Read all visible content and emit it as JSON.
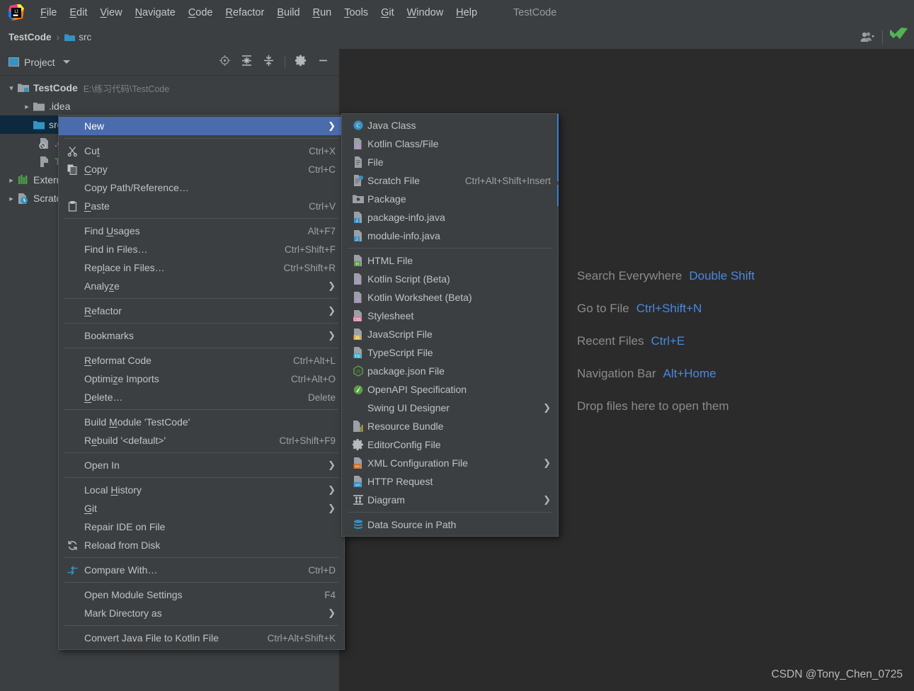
{
  "window": {
    "title": "TestCode",
    "progress_visible": true
  },
  "menubar": {
    "items": [
      {
        "label": "File"
      },
      {
        "label": "Edit"
      },
      {
        "label": "View"
      },
      {
        "label": "Navigate"
      },
      {
        "label": "Code"
      },
      {
        "label": "Refactor"
      },
      {
        "label": "Build"
      },
      {
        "label": "Run"
      },
      {
        "label": "Tools"
      },
      {
        "label": "Git"
      },
      {
        "label": "Window"
      },
      {
        "label": "Help"
      }
    ]
  },
  "breadcrumb": {
    "root": "TestCode",
    "separator": "›",
    "leaf": "src"
  },
  "toolwindow": {
    "title": "Project",
    "actions": [
      "locate-icon",
      "expand-all-icon",
      "collapse-all-icon",
      "settings-gear-icon",
      "hide-icon"
    ],
    "tree": [
      {
        "label": "TestCode",
        "detail": "E:\\练习代码\\TestCode",
        "arrow": "∨",
        "icon": "module-icon",
        "bold": true,
        "indent": 0,
        "selected": false
      },
      {
        "label": ".idea",
        "detail": "",
        "arrow": "›",
        "icon": "folder-icon",
        "bold": false,
        "indent": 1,
        "selected": false
      },
      {
        "label": "src",
        "detail": "",
        "arrow": "",
        "icon": "source-folder-icon",
        "bold": false,
        "indent": 1,
        "selected": true
      },
      {
        "label": ".gitignore",
        "detail": "",
        "arrow": "",
        "icon": "ignored-file-icon",
        "bold": false,
        "indent": 2,
        "selected": false
      },
      {
        "label": "TestCode.iml",
        "detail": "",
        "arrow": "",
        "icon": "iml-file-icon",
        "bold": false,
        "indent": 2,
        "selected": false
      },
      {
        "label": "External Libraries",
        "detail": "",
        "arrow": "›",
        "icon": "libraries-icon",
        "bold": false,
        "indent": 0,
        "selected": false
      },
      {
        "label": "Scratches and Consoles",
        "detail": "",
        "arrow": "›",
        "icon": "scratches-icon",
        "bold": false,
        "indent": 0,
        "selected": false
      }
    ]
  },
  "context_menu": {
    "groups": [
      [
        {
          "label": "New",
          "accel": "",
          "icon": "",
          "submenu": true,
          "highlighted": true
        }
      ],
      [
        {
          "label": "Cut",
          "accel": "Ctrl+X",
          "icon": "scissors-icon",
          "submenu": false,
          "highlighted": false,
          "mnemonic_index": 2
        },
        {
          "label": "Copy",
          "accel": "Ctrl+C",
          "icon": "copy-icon",
          "submenu": false,
          "highlighted": false,
          "mnemonic_index": 0
        },
        {
          "label": "Copy Path/Reference…",
          "accel": "",
          "icon": "",
          "submenu": false,
          "highlighted": false
        },
        {
          "label": "Paste",
          "accel": "Ctrl+V",
          "icon": "clipboard-icon",
          "submenu": false,
          "highlighted": false,
          "mnemonic_index": 0
        }
      ],
      [
        {
          "label": "Find Usages",
          "accel": "Alt+F7",
          "icon": "",
          "submenu": false,
          "highlighted": false,
          "mnemonic_index": 5
        },
        {
          "label": "Find in Files…",
          "accel": "Ctrl+Shift+F",
          "icon": "",
          "submenu": false,
          "highlighted": false
        },
        {
          "label": "Replace in Files…",
          "accel": "Ctrl+Shift+R",
          "icon": "",
          "submenu": false,
          "highlighted": false,
          "mnemonic_index": 3
        },
        {
          "label": "Analyze",
          "accel": "",
          "icon": "",
          "submenu": true,
          "highlighted": false,
          "mnemonic_index": 5
        }
      ],
      [
        {
          "label": "Refactor",
          "accel": "",
          "icon": "",
          "submenu": true,
          "highlighted": false,
          "mnemonic_index": 0
        }
      ],
      [
        {
          "label": "Bookmarks",
          "accel": "",
          "icon": "",
          "submenu": true,
          "highlighted": false
        }
      ],
      [
        {
          "label": "Reformat Code",
          "accel": "Ctrl+Alt+L",
          "icon": "",
          "submenu": false,
          "highlighted": false,
          "mnemonic_index": 0
        },
        {
          "label": "Optimize Imports",
          "accel": "Ctrl+Alt+O",
          "icon": "",
          "submenu": false,
          "highlighted": false,
          "mnemonic_index": 7
        },
        {
          "label": "Delete…",
          "accel": "Delete",
          "icon": "",
          "submenu": false,
          "highlighted": false,
          "mnemonic_index": 0
        }
      ],
      [
        {
          "label": "Build Module 'TestCode'",
          "accel": "",
          "icon": "",
          "submenu": false,
          "highlighted": false,
          "mnemonic_index": 6
        },
        {
          "label": "Rebuild '<default>'",
          "accel": "Ctrl+Shift+F9",
          "icon": "",
          "submenu": false,
          "highlighted": false,
          "mnemonic_index": 2
        }
      ],
      [
        {
          "label": "Open In",
          "accel": "",
          "icon": "",
          "submenu": true,
          "highlighted": false
        }
      ],
      [
        {
          "label": "Local History",
          "accel": "",
          "icon": "",
          "submenu": true,
          "highlighted": false,
          "mnemonic_index": 6
        },
        {
          "label": "Git",
          "accel": "",
          "icon": "",
          "submenu": true,
          "highlighted": false,
          "mnemonic_index": 0
        },
        {
          "label": "Repair IDE on File",
          "accel": "",
          "icon": "",
          "submenu": false,
          "highlighted": false
        },
        {
          "label": "Reload from Disk",
          "accel": "",
          "icon": "reload-icon",
          "submenu": false,
          "highlighted": false
        }
      ],
      [
        {
          "label": "Compare With…",
          "accel": "Ctrl+D",
          "icon": "compare-icon",
          "submenu": false,
          "highlighted": false
        }
      ],
      [
        {
          "label": "Open Module Settings",
          "accel": "F4",
          "icon": "",
          "submenu": false,
          "highlighted": false
        },
        {
          "label": "Mark Directory as",
          "accel": "",
          "icon": "",
          "submenu": true,
          "highlighted": false
        }
      ],
      [
        {
          "label": "Convert Java File to Kotlin File",
          "accel": "Ctrl+Alt+Shift+K",
          "icon": "",
          "submenu": false,
          "highlighted": false
        }
      ]
    ]
  },
  "submenu": {
    "groups": [
      [
        {
          "label": "Java Class",
          "accel": "",
          "icon": "java-class-icon",
          "submenu": false
        },
        {
          "label": "Kotlin Class/File",
          "accel": "",
          "icon": "kotlin-class-icon",
          "submenu": false
        },
        {
          "label": "File",
          "accel": "",
          "icon": "file-icon",
          "submenu": false
        },
        {
          "label": "Scratch File",
          "accel": "Ctrl+Alt+Shift+Insert",
          "icon": "scratch-file-icon",
          "submenu": false
        },
        {
          "label": "Package",
          "accel": "",
          "icon": "package-icon",
          "submenu": false
        },
        {
          "label": "package-info.java",
          "accel": "",
          "icon": "java-file-icon",
          "submenu": false
        },
        {
          "label": "module-info.java",
          "accel": "",
          "icon": "java-file-icon",
          "submenu": false
        }
      ],
      [
        {
          "label": "HTML File",
          "accel": "",
          "icon": "html-file-icon",
          "submenu": false
        },
        {
          "label": "Kotlin Script (Beta)",
          "accel": "",
          "icon": "kotlin-script-icon",
          "submenu": false
        },
        {
          "label": "Kotlin Worksheet (Beta)",
          "accel": "",
          "icon": "kotlin-worksheet-icon",
          "submenu": false
        },
        {
          "label": "Stylesheet",
          "accel": "",
          "icon": "css-file-icon",
          "submenu": false
        },
        {
          "label": "JavaScript File",
          "accel": "",
          "icon": "js-file-icon",
          "submenu": false
        },
        {
          "label": "TypeScript File",
          "accel": "",
          "icon": "ts-file-icon",
          "submenu": false
        },
        {
          "label": "package.json File",
          "accel": "",
          "icon": "nodejs-icon",
          "submenu": false
        },
        {
          "label": "OpenAPI Specification",
          "accel": "",
          "icon": "openapi-icon",
          "submenu": false
        },
        {
          "label": "Swing UI Designer",
          "accel": "",
          "icon": "",
          "submenu": true
        },
        {
          "label": "Resource Bundle",
          "accel": "",
          "icon": "resource-bundle-icon",
          "submenu": false
        },
        {
          "label": "EditorConfig File",
          "accel": "",
          "icon": "editorconfig-icon",
          "submenu": false
        },
        {
          "label": "XML Configuration File",
          "accel": "",
          "icon": "xml-file-icon",
          "submenu": true
        },
        {
          "label": "HTTP Request",
          "accel": "",
          "icon": "http-request-icon",
          "submenu": false
        },
        {
          "label": "Diagram",
          "accel": "",
          "icon": "diagram-icon",
          "submenu": true
        }
      ],
      [
        {
          "label": "Data Source in Path",
          "accel": "",
          "icon": "datasource-icon",
          "submenu": false
        }
      ]
    ]
  },
  "editor_hints": [
    {
      "label": "Search Everywhere",
      "key": "Double Shift"
    },
    {
      "label": "Go to File",
      "key": "Ctrl+Shift+N"
    },
    {
      "label": "Recent Files",
      "key": "Ctrl+E"
    },
    {
      "label": "Navigation Bar",
      "key": "Alt+Home"
    },
    {
      "label": "Drop files here to open them",
      "key": ""
    }
  ],
  "watermark": "CSDN @Tony_Chen_0725",
  "colors": {
    "menu_bg": "#3c3f41",
    "editor_bg": "#2b2b2b",
    "highlight": "#4a6cad",
    "accent_blue": "#4a88e0",
    "selection_row": "#0d293e",
    "progress_fill": "#1e8ddd"
  }
}
